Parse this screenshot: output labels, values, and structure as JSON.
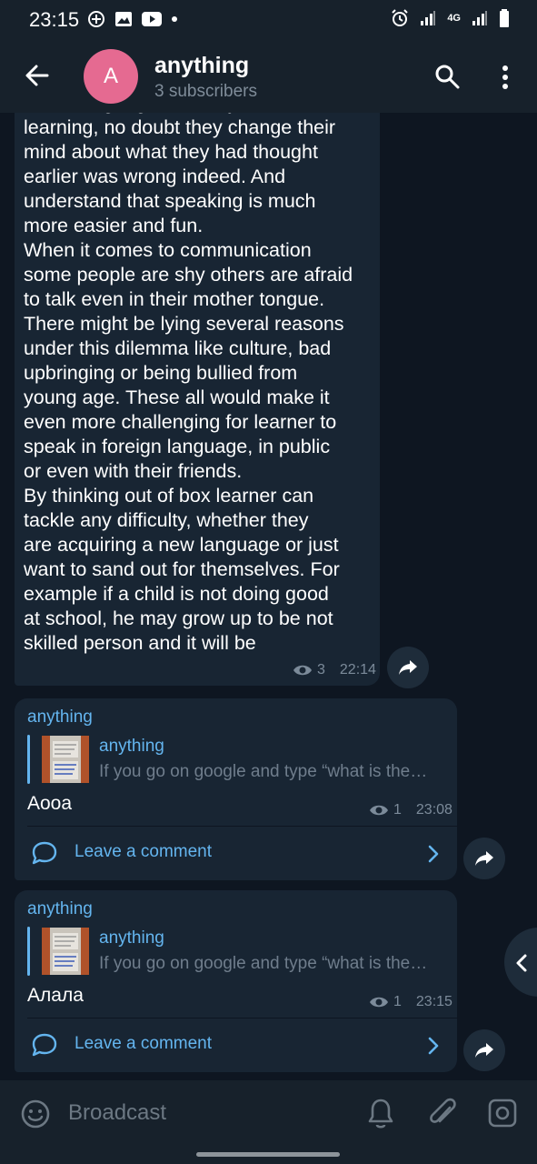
{
  "status_bar": {
    "time": "23:15",
    "network": "4G",
    "icons": [
      "notification-dot-icon",
      "image-icon",
      "youtube-icon",
      "alarm-icon",
      "signal-icon",
      "battery-icon"
    ]
  },
  "header": {
    "avatar_letter": "A",
    "title": "anything",
    "subtitle": "3 subscribers",
    "avatar_color": "#e56a91"
  },
  "messages": {
    "first": {
      "text": "in the language that they have been\nlearning, no doubt they change their\nmind about what they had thought\nearlier was wrong indeed. And\nunderstand that speaking is much\nmore easier and fun.\nWhen it comes to communication\nsome people are shy others are afraid\nto talk even in their mother tongue.\nThere might be lying several reasons\nunder this dilemma like culture, bad\nupbringing or being bullied from\nyoung age. These all would make it\neven more challenging for learner to\nspeak in foreign language, in public\nor even with their friends.\nBy thinking out of box learner can\ntackle any difficulty, whether they\nare acquiring a new language or just\nwant to sand out for themselves. For\nexample if a child is not doing good\nat school, he may grow up to be not\nskilled person and it will be",
      "views": "3",
      "time": "22:14"
    },
    "posts": [
      {
        "author": "anything",
        "reply_name": "anything",
        "reply_text": "If you go on google and type “what is the…",
        "text": "Аооа",
        "views": "1",
        "time": "23:08",
        "comment_label": "Leave a comment"
      },
      {
        "author": "anything",
        "reply_name": "anything",
        "reply_text": "If you go on google and type “what is the…",
        "text": "Алала",
        "views": "1",
        "time": "23:15",
        "comment_label": "Leave a comment"
      }
    ]
  },
  "input_bar": {
    "placeholder": "Broadcast"
  },
  "colors": {
    "background": "#0e1621",
    "bubble": "#182533",
    "accent": "#64b5ef",
    "header": "#17212b"
  }
}
